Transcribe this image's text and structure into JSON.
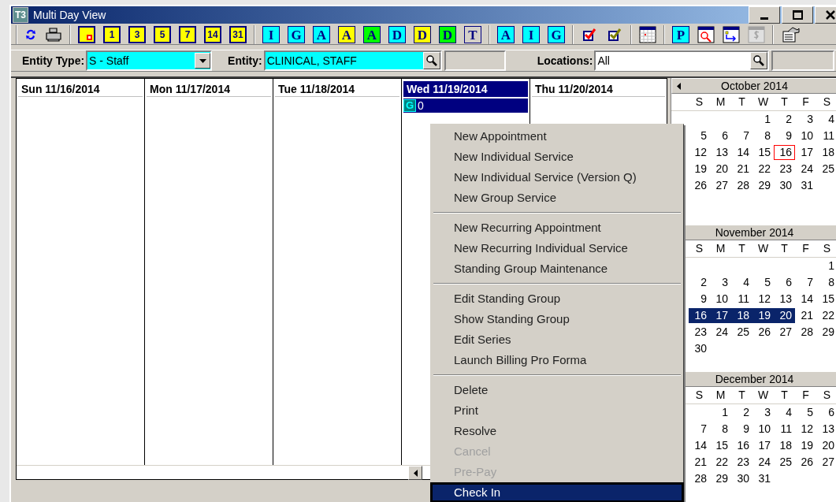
{
  "window": {
    "title": "Multi Day View",
    "app_icon": "T3"
  },
  "toolbar": [
    {
      "kind": "refresh"
    },
    {
      "kind": "print"
    },
    {
      "kind": "sep"
    },
    {
      "kind": "day",
      "marked": true
    },
    {
      "kind": "day",
      "label": "1",
      "marked": false
    },
    {
      "kind": "day",
      "label": "3",
      "marked": false
    },
    {
      "kind": "day",
      "label": "5",
      "marked": false
    },
    {
      "kind": "day",
      "label": "7",
      "marked": false
    },
    {
      "kind": "day",
      "label": "14",
      "marked": false
    },
    {
      "kind": "day",
      "label": "31",
      "marked": false
    },
    {
      "kind": "sep"
    },
    {
      "kind": "letter",
      "label": "I",
      "color": "#00ffff"
    },
    {
      "kind": "letter",
      "label": "G",
      "color": "#00ffff"
    },
    {
      "kind": "letter",
      "label": "A",
      "color": "#00ffff"
    },
    {
      "kind": "letter",
      "label": "A",
      "color": "#ffff00"
    },
    {
      "kind": "letter",
      "label": "A",
      "color": "#00ff00"
    },
    {
      "kind": "letter",
      "label": "D",
      "color": "#00ffff"
    },
    {
      "kind": "letter",
      "label": "D",
      "color": "#ffff00"
    },
    {
      "kind": "letter",
      "label": "D",
      "color": "#00ff00"
    },
    {
      "kind": "letter",
      "label": "T",
      "color": "#d4d0c8"
    },
    {
      "kind": "sep"
    },
    {
      "kind": "letter",
      "label": "A",
      "color": "#00ffff"
    },
    {
      "kind": "letter",
      "label": "I",
      "color": "#00ffff"
    },
    {
      "kind": "letter",
      "label": "G",
      "color": "#00ffff"
    },
    {
      "kind": "sep"
    },
    {
      "kind": "check",
      "color": "#ff0000"
    },
    {
      "kind": "check",
      "color": "#808000"
    },
    {
      "kind": "sep"
    },
    {
      "kind": "calendar"
    },
    {
      "kind": "sep"
    },
    {
      "kind": "letter",
      "label": "P",
      "color": "#00ffff"
    },
    {
      "kind": "find"
    },
    {
      "kind": "move"
    },
    {
      "kind": "dollar"
    },
    {
      "kind": "sep"
    },
    {
      "kind": "properties"
    }
  ],
  "filters": {
    "entity_type": {
      "label": "Entity Type:",
      "value": "S - Staff"
    },
    "entity": {
      "label": "Entity:",
      "value": "CLINICAL, STAFF"
    },
    "locations": {
      "label": "Locations:",
      "value": "All"
    }
  },
  "days": [
    {
      "header": "Sun 11/16/2014",
      "selected": false
    },
    {
      "header": "Mon 11/17/2014",
      "selected": false
    },
    {
      "header": "Tue 11/18/2014",
      "selected": false
    },
    {
      "header": "Wed 11/19/2014",
      "selected": true,
      "appointments": [
        {
          "badge": "G",
          "text": "0"
        }
      ]
    },
    {
      "header": "Thu 11/20/2014",
      "selected": false
    }
  ],
  "context_menu": [
    {
      "kind": "item",
      "label": "New Appointment",
      "disabled": false,
      "selected": false
    },
    {
      "kind": "item",
      "label": "New Individual Service",
      "disabled": false,
      "selected": false
    },
    {
      "kind": "item",
      "label": "New Individual Service (Version Q)",
      "disabled": false,
      "selected": false
    },
    {
      "kind": "item",
      "label": "New Group Service",
      "disabled": false,
      "selected": false
    },
    {
      "kind": "separator"
    },
    {
      "kind": "item",
      "label": "New Recurring Appointment",
      "disabled": false,
      "selected": false
    },
    {
      "kind": "item",
      "label": "New Recurring Individual Service",
      "disabled": false,
      "selected": false
    },
    {
      "kind": "item",
      "label": "Standing Group Maintenance",
      "disabled": false,
      "selected": false
    },
    {
      "kind": "separator"
    },
    {
      "kind": "item",
      "label": "Edit Standing Group",
      "disabled": false,
      "selected": false
    },
    {
      "kind": "item",
      "label": "Show Standing Group",
      "disabled": false,
      "selected": false
    },
    {
      "kind": "item",
      "label": "Edit Series",
      "disabled": false,
      "selected": false
    },
    {
      "kind": "item",
      "label": "Launch Billing Pro Forma",
      "disabled": false,
      "selected": false
    },
    {
      "kind": "separator"
    },
    {
      "kind": "item",
      "label": "Delete",
      "disabled": false,
      "selected": false
    },
    {
      "kind": "item",
      "label": "Print",
      "disabled": false,
      "selected": false
    },
    {
      "kind": "item",
      "label": "Resolve",
      "disabled": false,
      "selected": false
    },
    {
      "kind": "item",
      "label": "Cancel",
      "disabled": true,
      "selected": false
    },
    {
      "kind": "item",
      "label": "Pre-Pay",
      "disabled": true,
      "selected": false
    },
    {
      "kind": "item",
      "label": "Check In",
      "disabled": false,
      "selected": true
    }
  ],
  "mini_calendars": [
    {
      "title": "October 2014",
      "prev_arrow": true,
      "weekdays": [
        "S",
        "M",
        "T",
        "W",
        "T",
        "F",
        "S"
      ],
      "weeks": [
        [
          {
            "kind": "blank"
          },
          {
            "kind": "blank"
          },
          {
            "kind": "blank"
          },
          {
            "kind": "day",
            "day": "1",
            "selected": false,
            "boxed": false
          },
          {
            "kind": "day",
            "day": "2",
            "selected": false,
            "boxed": false
          },
          {
            "kind": "day",
            "day": "3",
            "selected": false,
            "boxed": false
          },
          {
            "kind": "day",
            "day": "4",
            "selected": false,
            "boxed": false
          }
        ],
        [
          {
            "kind": "day",
            "day": "5",
            "selected": false,
            "boxed": false
          },
          {
            "kind": "day",
            "day": "6",
            "selected": false,
            "boxed": false
          },
          {
            "kind": "day",
            "day": "7",
            "selected": false,
            "boxed": false
          },
          {
            "kind": "day",
            "day": "8",
            "selected": false,
            "boxed": false
          },
          {
            "kind": "day",
            "day": "9",
            "selected": false,
            "boxed": false
          },
          {
            "kind": "day",
            "day": "10",
            "selected": false,
            "boxed": false
          },
          {
            "kind": "day",
            "day": "11",
            "selected": false,
            "boxed": false
          }
        ],
        [
          {
            "kind": "day",
            "day": "12",
            "selected": false,
            "boxed": false
          },
          {
            "kind": "day",
            "day": "13",
            "selected": false,
            "boxed": false
          },
          {
            "kind": "day",
            "day": "14",
            "selected": false,
            "boxed": false
          },
          {
            "kind": "day",
            "day": "15",
            "selected": false,
            "boxed": false
          },
          {
            "kind": "day",
            "day": "16",
            "selected": false,
            "boxed": true
          },
          {
            "kind": "day",
            "day": "17",
            "selected": false,
            "boxed": false
          },
          {
            "kind": "day",
            "day": "18",
            "selected": false,
            "boxed": false
          }
        ],
        [
          {
            "kind": "day",
            "day": "19",
            "selected": false,
            "boxed": false
          },
          {
            "kind": "day",
            "day": "20",
            "selected": false,
            "boxed": false
          },
          {
            "kind": "day",
            "day": "21",
            "selected": false,
            "boxed": false
          },
          {
            "kind": "day",
            "day": "22",
            "selected": false,
            "boxed": false
          },
          {
            "kind": "day",
            "day": "23",
            "selected": false,
            "boxed": false
          },
          {
            "kind": "day",
            "day": "24",
            "selected": false,
            "boxed": false
          },
          {
            "kind": "day",
            "day": "25",
            "selected": false,
            "boxed": false
          }
        ],
        [
          {
            "kind": "day",
            "day": "26",
            "selected": false,
            "boxed": false
          },
          {
            "kind": "day",
            "day": "27",
            "selected": false,
            "boxed": false
          },
          {
            "kind": "day",
            "day": "28",
            "selected": false,
            "boxed": false
          },
          {
            "kind": "day",
            "day": "29",
            "selected": false,
            "boxed": false
          },
          {
            "kind": "day",
            "day": "30",
            "selected": false,
            "boxed": false
          },
          {
            "kind": "day",
            "day": "31",
            "selected": false,
            "boxed": false
          }
        ]
      ]
    },
    {
      "title": "November 2014",
      "weekdays": [
        "S",
        "M",
        "T",
        "W",
        "T",
        "F",
        "S"
      ],
      "weeks": [
        [
          {
            "kind": "blank"
          },
          {
            "kind": "blank"
          },
          {
            "kind": "blank"
          },
          {
            "kind": "blank"
          },
          {
            "kind": "blank"
          },
          {
            "kind": "blank"
          },
          {
            "kind": "day",
            "day": "1",
            "selected": false,
            "boxed": false
          }
        ],
        [
          {
            "kind": "day",
            "day": "2",
            "selected": false,
            "boxed": false
          },
          {
            "kind": "day",
            "day": "3",
            "selected": false,
            "boxed": false
          },
          {
            "kind": "day",
            "day": "4",
            "selected": false,
            "boxed": false
          },
          {
            "kind": "day",
            "day": "5",
            "selected": false,
            "boxed": false
          },
          {
            "kind": "day",
            "day": "6",
            "selected": false,
            "boxed": false
          },
          {
            "kind": "day",
            "day": "7",
            "selected": false,
            "boxed": false
          },
          {
            "kind": "day",
            "day": "8",
            "selected": false,
            "boxed": false
          }
        ],
        [
          {
            "kind": "day",
            "day": "9",
            "selected": false,
            "boxed": false
          },
          {
            "kind": "day",
            "day": "10",
            "selected": false,
            "boxed": false
          },
          {
            "kind": "day",
            "day": "11",
            "selected": false,
            "boxed": false
          },
          {
            "kind": "day",
            "day": "12",
            "selected": false,
            "boxed": false
          },
          {
            "kind": "day",
            "day": "13",
            "selected": false,
            "boxed": false
          },
          {
            "kind": "day",
            "day": "14",
            "selected": false,
            "boxed": false
          },
          {
            "kind": "day",
            "day": "15",
            "selected": false,
            "boxed": false
          }
        ],
        [
          {
            "kind": "day",
            "day": "16",
            "selected": true,
            "boxed": false
          },
          {
            "kind": "day",
            "day": "17",
            "selected": true,
            "boxed": false
          },
          {
            "kind": "day",
            "day": "18",
            "selected": true,
            "boxed": false
          },
          {
            "kind": "day",
            "day": "19",
            "selected": true,
            "boxed": false
          },
          {
            "kind": "day",
            "day": "20",
            "selected": true,
            "boxed": false
          },
          {
            "kind": "day",
            "day": "21",
            "selected": false,
            "boxed": false
          },
          {
            "kind": "day",
            "day": "22",
            "selected": false,
            "boxed": false
          }
        ],
        [
          {
            "kind": "day",
            "day": "23",
            "selected": false,
            "boxed": false
          },
          {
            "kind": "day",
            "day": "24",
            "selected": false,
            "boxed": false
          },
          {
            "kind": "day",
            "day": "25",
            "selected": false,
            "boxed": false
          },
          {
            "kind": "day",
            "day": "26",
            "selected": false,
            "boxed": false
          },
          {
            "kind": "day",
            "day": "27",
            "selected": false,
            "boxed": false
          },
          {
            "kind": "day",
            "day": "28",
            "selected": false,
            "boxed": false
          },
          {
            "kind": "day",
            "day": "29",
            "selected": false,
            "boxed": false
          }
        ],
        [
          {
            "kind": "day",
            "day": "30",
            "selected": false,
            "boxed": false
          }
        ]
      ]
    },
    {
      "title": "December 2014",
      "weekdays": [
        "S",
        "M",
        "T",
        "W",
        "T",
        "F",
        "S"
      ],
      "weeks": [
        [
          {
            "kind": "blank"
          },
          {
            "kind": "day",
            "day": "1",
            "selected": false,
            "boxed": false
          },
          {
            "kind": "day",
            "day": "2",
            "selected": false,
            "boxed": false
          },
          {
            "kind": "day",
            "day": "3",
            "selected": false,
            "boxed": false
          },
          {
            "kind": "day",
            "day": "4",
            "selected": false,
            "boxed": false
          },
          {
            "kind": "day",
            "day": "5",
            "selected": false,
            "boxed": false
          },
          {
            "kind": "day",
            "day": "6",
            "selected": false,
            "boxed": false
          }
        ],
        [
          {
            "kind": "day",
            "day": "7",
            "selected": false,
            "boxed": false
          },
          {
            "kind": "day",
            "day": "8",
            "selected": false,
            "boxed": false
          },
          {
            "kind": "day",
            "day": "9",
            "selected": false,
            "boxed": false
          },
          {
            "kind": "day",
            "day": "10",
            "selected": false,
            "boxed": false
          },
          {
            "kind": "day",
            "day": "11",
            "selected": false,
            "boxed": false
          },
          {
            "kind": "day",
            "day": "12",
            "selected": false,
            "boxed": false
          },
          {
            "kind": "day",
            "day": "13",
            "selected": false,
            "boxed": false
          }
        ],
        [
          {
            "kind": "day",
            "day": "14",
            "selected": false,
            "boxed": false
          },
          {
            "kind": "day",
            "day": "15",
            "selected": false,
            "boxed": false
          },
          {
            "kind": "day",
            "day": "16",
            "selected": false,
            "boxed": false
          },
          {
            "kind": "day",
            "day": "17",
            "selected": false,
            "boxed": false
          },
          {
            "kind": "day",
            "day": "18",
            "selected": false,
            "boxed": false
          },
          {
            "kind": "day",
            "day": "19",
            "selected": false,
            "boxed": false
          },
          {
            "kind": "day",
            "day": "20",
            "selected": false,
            "boxed": false
          }
        ],
        [
          {
            "kind": "day",
            "day": "21",
            "selected": false,
            "boxed": false
          },
          {
            "kind": "day",
            "day": "22",
            "selected": false,
            "boxed": false
          },
          {
            "kind": "day",
            "day": "23",
            "selected": false,
            "boxed": false
          },
          {
            "kind": "day",
            "day": "24",
            "selected": false,
            "boxed": false
          },
          {
            "kind": "day",
            "day": "25",
            "selected": false,
            "boxed": false
          },
          {
            "kind": "day",
            "day": "26",
            "selected": false,
            "boxed": false
          },
          {
            "kind": "day",
            "day": "27",
            "selected": false,
            "boxed": false
          }
        ],
        [
          {
            "kind": "day",
            "day": "28",
            "selected": false,
            "boxed": false
          },
          {
            "kind": "day",
            "day": "29",
            "selected": false,
            "boxed": false
          },
          {
            "kind": "day",
            "day": "30",
            "selected": false,
            "boxed": false
          },
          {
            "kind": "day",
            "day": "31",
            "selected": false,
            "boxed": false
          }
        ]
      ]
    }
  ]
}
